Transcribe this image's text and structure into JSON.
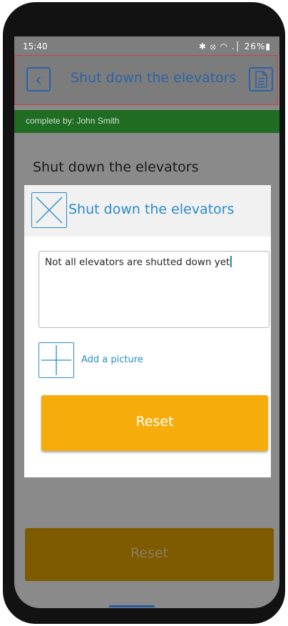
{
  "status_bar": {
    "time": "15:40",
    "icons_text": "✱ ⦻ ◠ .│ 26%▮",
    "battery": "26%"
  },
  "header": {
    "title": "Shut down the elevators",
    "back_icon": "chevron-left-icon",
    "doc_icon": "document-icon"
  },
  "assignment": {
    "text": "complete by: John Smith"
  },
  "background": {
    "task_title": "Shut down the elevators",
    "reset_label": "Reset"
  },
  "dialog": {
    "title": "Shut down the elevators",
    "close_icon": "close-icon",
    "comment_value": "Not all elevators are shutted down yet",
    "add_picture_label": "Add a picture",
    "add_icon": "plus-icon",
    "reset_label": "Reset"
  },
  "colors": {
    "accent_blue": "#2a8cc9",
    "header_blue": "#2b63a6",
    "reset_orange": "#f6ac0a",
    "assignment_green": "#1f6c22",
    "header_border_red": "#c2454b"
  }
}
